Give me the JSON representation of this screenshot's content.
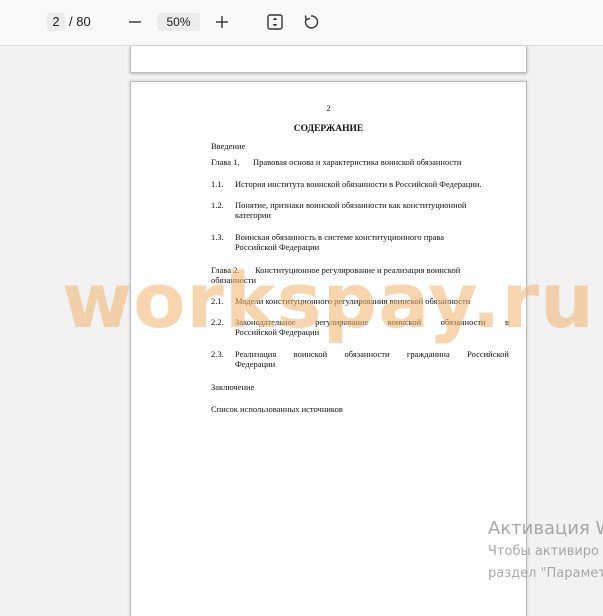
{
  "toolbar": {
    "current_page": "2",
    "total_pages": "/ 80",
    "zoom": "50%",
    "icons": [
      "minus-icon",
      "plus-icon",
      "fit-page-icon",
      "rotate-icon"
    ]
  },
  "document": {
    "page_number": "2",
    "toc_title": "СОДЕРЖАНИЕ",
    "entries": [
      {
        "num": "",
        "text": "Введение"
      },
      {
        "num": "Глава 1.",
        "text": "Правовая основа и характеристика воинской обязанности"
      },
      {
        "num": "1.1.",
        "text": "История института воинской обязанности в Российской Федерации."
      },
      {
        "num": "1.2.",
        "line1": "Понятие, признаки воинской обязанности как конституционной",
        "line2": "категории"
      },
      {
        "num": "1.3.",
        "line1": "Воинская обязанность в системе конституционного права",
        "line2": "Российской Федерации"
      },
      {
        "num": "Глава 2.",
        "line1": "Конституционное регулирование и реализация воинской",
        "line2": "обязанности"
      },
      {
        "num": "2.1.",
        "text": "Модели конституционного регулирования воинской обязанности"
      },
      {
        "num": "2.2.",
        "line1": "Законодательное регулирование воинской обязанности в",
        "line2": "Российской Федерации"
      },
      {
        "num": "2.3.",
        "line1": "Реализация воинской обязанности гражданина Российской",
        "line2": "Федерации"
      },
      {
        "num": "",
        "text": "Заключение"
      },
      {
        "num": "",
        "text": "Список использованных источников"
      }
    ]
  },
  "watermark": "workspay.ru",
  "activation": {
    "title": "Активация W",
    "line1": "Чтобы активиро",
    "line2": "раздел \"Парамет"
  }
}
